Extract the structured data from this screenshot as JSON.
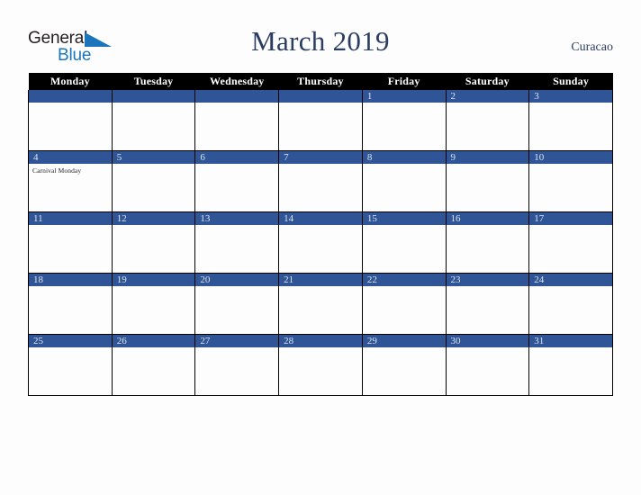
{
  "brand": {
    "name_part1": "General",
    "name_part2": "Blue",
    "accent_color": "#1b75bb",
    "triangle_icon": "triangle-icon"
  },
  "header": {
    "title": "March 2019",
    "country": "Curacao",
    "title_color": "#2b3d63"
  },
  "calendar": {
    "month": "March",
    "year": "2019",
    "header_bg": "#000000",
    "daybar_bg": "#2f5596",
    "weekday_headers": [
      "Monday",
      "Tuesday",
      "Wednesday",
      "Thursday",
      "Friday",
      "Saturday",
      "Sunday"
    ],
    "weeks": [
      [
        {
          "date": "",
          "events": []
        },
        {
          "date": "",
          "events": []
        },
        {
          "date": "",
          "events": []
        },
        {
          "date": "",
          "events": []
        },
        {
          "date": "1",
          "events": []
        },
        {
          "date": "2",
          "events": []
        },
        {
          "date": "3",
          "events": []
        }
      ],
      [
        {
          "date": "4",
          "events": [
            "Carnival Monday"
          ]
        },
        {
          "date": "5",
          "events": []
        },
        {
          "date": "6",
          "events": []
        },
        {
          "date": "7",
          "events": []
        },
        {
          "date": "8",
          "events": []
        },
        {
          "date": "9",
          "events": []
        },
        {
          "date": "10",
          "events": []
        }
      ],
      [
        {
          "date": "11",
          "events": []
        },
        {
          "date": "12",
          "events": []
        },
        {
          "date": "13",
          "events": []
        },
        {
          "date": "14",
          "events": []
        },
        {
          "date": "15",
          "events": []
        },
        {
          "date": "16",
          "events": []
        },
        {
          "date": "17",
          "events": []
        }
      ],
      [
        {
          "date": "18",
          "events": []
        },
        {
          "date": "19",
          "events": []
        },
        {
          "date": "20",
          "events": []
        },
        {
          "date": "21",
          "events": []
        },
        {
          "date": "22",
          "events": []
        },
        {
          "date": "23",
          "events": []
        },
        {
          "date": "24",
          "events": []
        }
      ],
      [
        {
          "date": "25",
          "events": []
        },
        {
          "date": "26",
          "events": []
        },
        {
          "date": "27",
          "events": []
        },
        {
          "date": "28",
          "events": []
        },
        {
          "date": "29",
          "events": []
        },
        {
          "date": "30",
          "events": []
        },
        {
          "date": "31",
          "events": []
        }
      ]
    ]
  }
}
